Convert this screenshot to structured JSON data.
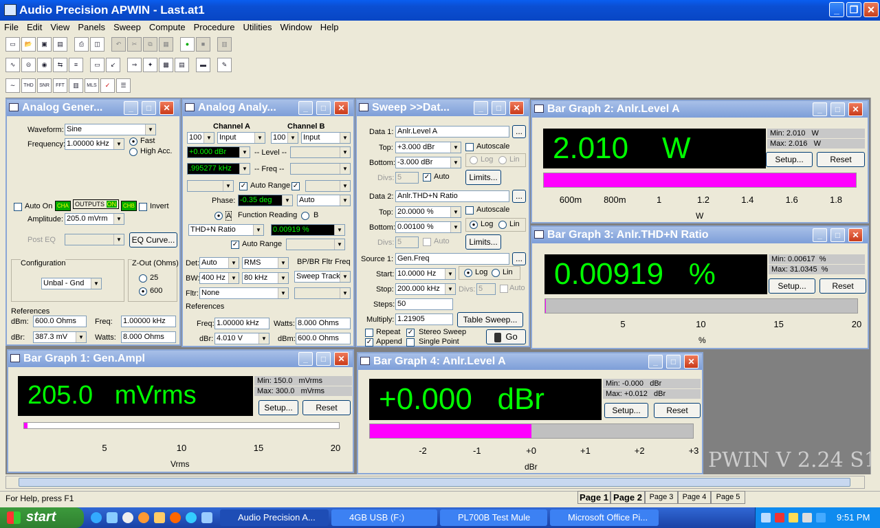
{
  "app": {
    "title": "Audio Precision APWIN - Last.at1"
  },
  "menu": [
    "File",
    "Edit",
    "View",
    "Panels",
    "Sweep",
    "Compute",
    "Procedure",
    "Utilities",
    "Window",
    "Help"
  ],
  "toolbar": {
    "row1": [
      "new-icon",
      "open-icon",
      "save-icon",
      "save-all-icon",
      "print-icon",
      "print-preview-icon",
      "undo-icon",
      "cut-icon",
      "copy-icon",
      "paste-icon",
      "go-icon",
      "stop-icon",
      "panel-icon"
    ],
    "row2": [
      "generator-icon",
      "analyzer-icon",
      "dcx-icon",
      "switcher-icon",
      "stat-bit-icon",
      "dcx2-icon",
      "filter-icon",
      "sweep-icon",
      "spectrum-icon",
      "graph-icon",
      "data-icon",
      "meter-icon",
      "notes-icon"
    ],
    "row3": [
      "graph-icon",
      "thd-icon",
      "snr-icon",
      "fft-icon",
      "bar-icon",
      "mls-icon",
      "check-icon",
      "list-icon"
    ]
  },
  "gen": {
    "title": "Analog Gener...",
    "waveform_label": "Waveform:",
    "waveform": "Sine",
    "frequency_label": "Frequency:",
    "frequency": "1.00000 kHz",
    "fast": "Fast",
    "high_acc": "High Acc.",
    "auto_on": "Auto On",
    "cha": "CHA",
    "outputs": "OUTPUTS",
    "on": "ON",
    "chb": "CHB",
    "invert": "Invert",
    "amplitude_label": "Amplitude:",
    "amplitude": "205.0   mVrm",
    "post_eq": "Post EQ",
    "eq_curve": "EQ Curve...",
    "configuration": "Configuration",
    "config_value": "Unbal - Gnd",
    "zout": "Z-Out (Ohms)",
    "z25": "25",
    "z600": "600",
    "references": "References",
    "dbm_label": "dBm:",
    "dbm": "600.0    Ohms",
    "freq_label": "Freq:",
    "freq": "1.00000 kHz",
    "dbr_label": "dBr:",
    "dbr": "387.3    mV",
    "watts_label": "Watts:",
    "watts": "8.000    Ohms"
  },
  "anlr": {
    "title": "Analog Analy...",
    "channel_a": "Channel A",
    "channel_b": "Channel B",
    "range_a": "100",
    "input_a": "Input",
    "range_b": "100",
    "input_b": "Input",
    "level_a": "+0.000   dBr",
    "level_label": "-- Level --",
    "freq_a": ".995277 kHz",
    "freq_label": "-- Freq --",
    "auto_range": "Auto Range",
    "phase_label": "Phase:",
    "phase": "-0.35   deg",
    "phase_mode": "Auto",
    "function_reading": "Function Reading",
    "a": "A",
    "b": "B",
    "function": "THD+N Ratio",
    "function_value": "0.00919  %",
    "auto_range2": "Auto Range",
    "det_label": "Det:",
    "det": "Auto",
    "det_type": "RMS",
    "bpbr": "BP/BR Fltr Freq",
    "bw_label": "BW:",
    "bw_low": "400 Hz",
    "bw_high": "80 kHz",
    "sweep_track": "Sweep Track",
    "fltr_label": "Fltr:",
    "fltr": "None",
    "references": "References",
    "freq_ref_label": "Freq:",
    "freq_ref": "1.00000 kHz",
    "watts_label": "Watts:",
    "watts": "8.000    Ohms",
    "dbr_label": "dBr:",
    "dbr": "4.010    V",
    "dbm_label": "dBm:",
    "dbm": "600.0    Ohms"
  },
  "sweep": {
    "title": "Sweep >>Dat...",
    "data1_label": "Data 1:",
    "data1": "Anlr.Level A",
    "top_label": "Top:",
    "top1": "+3.000   dBr",
    "bottom_label": "Bottom:",
    "bottom1": "-3.000   dBr",
    "divs_label": "Divs:",
    "divs1": "5",
    "autoscale": "Autoscale",
    "log": "Log",
    "lin": "Lin",
    "auto": "Auto",
    "limits": "Limits...",
    "data2_label": "Data 2:",
    "data2": "Anlr.THD+N Ratio",
    "top2": "20.0000  %",
    "bottom2": "0.00100  %",
    "divs2": "5",
    "source1_label": "Source 1:",
    "source1": "Gen.Freq",
    "start_label": "Start:",
    "start": "10.0000  Hz",
    "stop_label": "Stop:",
    "stop": "200.000 kHz",
    "divs3": "5",
    "steps_label": "Steps:",
    "steps": "50",
    "multiply_label": "Multiply:",
    "multiply": "1.21905",
    "table_sweep": "Table Sweep...",
    "repeat": "Repeat",
    "stereo_sweep": "Stereo Sweep",
    "append": "Append",
    "single_point": "Single Point",
    "go": "Go"
  },
  "bg2": {
    "title": "Bar Graph 2: Anlr.Level A",
    "reading": "2.010    W",
    "min": "Min: 2.010   W",
    "max": "Max: 2.016   W",
    "setup": "Setup...",
    "reset": "Reset",
    "ticks": [
      "600m",
      "800m",
      "1",
      "1.2",
      "1.4",
      "1.6",
      "1.8"
    ],
    "unit": "W",
    "fill": 1.0
  },
  "bg3": {
    "title": "Bar Graph 3: Anlr.THD+N Ratio",
    "reading": "0.00919   %",
    "min": "Min: 0.00617  %",
    "max": "Max: 31.0345  %",
    "setup": "Setup...",
    "reset": "Reset",
    "ticks": [
      "5",
      "10",
      "15",
      "20"
    ],
    "unit": "%",
    "fill": 0.0005
  },
  "bg1": {
    "title": "Bar Graph 1: Gen.Ampl",
    "reading": "205.0   mVrms",
    "min": "Min: 150.0   mVrms",
    "max": "Max: 300.0   mVrms",
    "setup": "Setup...",
    "reset": "Reset",
    "ticks": [
      "5",
      "10",
      "15",
      "20"
    ],
    "unit": "Vrms",
    "fill": 0.01
  },
  "bg4": {
    "title": "Bar Graph 4: Anlr.Level A",
    "reading": "+0.000   dBr",
    "min": "Min: -0.000   dBr",
    "max": "Max: +0.012   dBr",
    "setup": "Setup...",
    "reset": "Reset",
    "ticks": [
      "-2",
      "-1",
      "+0",
      "+1",
      "+2",
      "+3"
    ],
    "unit": "dBr",
    "fill": 0.5
  },
  "watermark": "PWIN V 2.24  S1",
  "status": {
    "help": "For Help, press F1"
  },
  "pages": [
    "Page 1",
    "Page 2",
    "Page 3",
    "Page 4",
    "Page 5"
  ],
  "taskbar": {
    "start": "start",
    "tasks": [
      "Audio Precision A...",
      "4GB USB (F:)",
      "PL700B Test Mule",
      "Microsoft Office Pi..."
    ],
    "time": "9:51 PM"
  },
  "colors": {
    "bar_fill": "#ff00ff",
    "display_text": "#00ff00",
    "title_active": "#0b4fd3"
  }
}
